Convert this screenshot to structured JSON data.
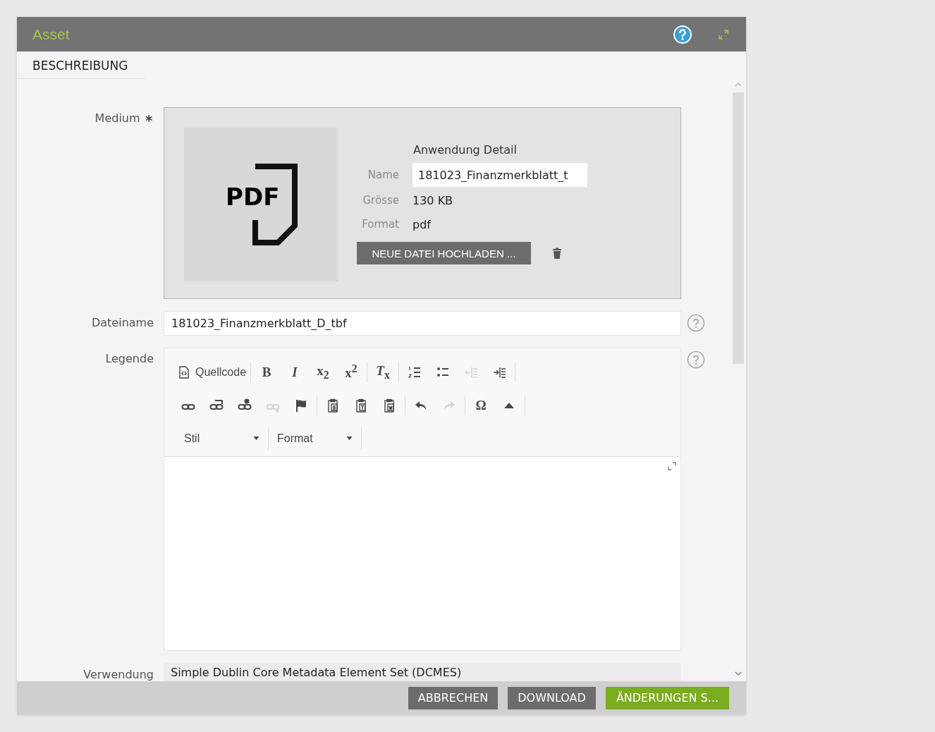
{
  "dialog": {
    "title": "Asset",
    "section": "BESCHREIBUNG"
  },
  "medium": {
    "label": "Medium",
    "required_mark": "∗",
    "preview_text": "PDF",
    "detail_title": "Anwendung Detail",
    "upload_button": "NEUE DATEI HOCHLADEN ...",
    "fields": [
      {
        "label": "Name",
        "value": "181023_Finanzmerkblatt_t",
        "kind": "input"
      },
      {
        "label": "Grösse",
        "value": "130 KB",
        "kind": "text"
      },
      {
        "label": "Format",
        "value": "pdf",
        "kind": "text"
      }
    ]
  },
  "filename": {
    "label": "Dateiname",
    "value": "181023_Finanzmerkblatt_D_tbf"
  },
  "legend": {
    "label": "Legende",
    "toolbar": [
      [
        [
          {
            "kind": "source",
            "label": "Quellcode",
            "disabled": false
          }
        ],
        [
          {
            "kind": "glyph",
            "glyph": "B",
            "disabled": false
          },
          {
            "kind": "glyph",
            "glyph": "*I*",
            "disabled": false
          },
          {
            "kind": "glyph",
            "glyph": "x$_{2}$",
            "disabled": false
          },
          {
            "kind": "glyph",
            "glyph": "x$^{2}$",
            "disabled": false
          }
        ],
        [
          {
            "kind": "glyph",
            "glyph": "*T*$_{x}$",
            "disabled": false
          }
        ],
        [
          {
            "kind": "numberedlist",
            "disabled": false
          },
          {
            "kind": "bulletlist",
            "disabled": false
          },
          {
            "kind": "outdent",
            "disabled": true
          },
          {
            "kind": "indent",
            "disabled": false
          }
        ]
      ],
      [
        [
          {
            "kind": "link",
            "disabled": false
          },
          {
            "kind": "linkwindow",
            "disabled": false
          },
          {
            "kind": "linkperson",
            "disabled": false
          },
          {
            "kind": "unlink",
            "disabled": true
          },
          {
            "kind": "flag",
            "disabled": false
          }
        ],
        [
          {
            "kind": "paste",
            "disabled": false
          },
          {
            "kind": "pastetext",
            "disabled": false
          },
          {
            "kind": "pasteword",
            "disabled": false
          }
        ],
        [
          {
            "kind": "undo",
            "disabled": false
          },
          {
            "kind": "redo",
            "disabled": true
          }
        ],
        [
          {
            "kind": "glyph",
            "glyph": "Ω",
            "disabled": false
          },
          {
            "kind": "collapse",
            "disabled": false
          }
        ]
      ]
    ],
    "dropdowns": [
      {
        "label": "Stil"
      },
      {
        "label": "Format"
      }
    ]
  },
  "usage": {
    "label": "Verwendung",
    "value": "Simple Dublin Core Metadata Element Set (DCMES)"
  },
  "buttons": [
    {
      "label": "ABBRECHEN",
      "kind": "secondary"
    },
    {
      "label": "DOWNLOAD",
      "kind": "secondary"
    },
    {
      "label": "ÄNDERUNGEN S...",
      "kind": "primary"
    }
  ]
}
